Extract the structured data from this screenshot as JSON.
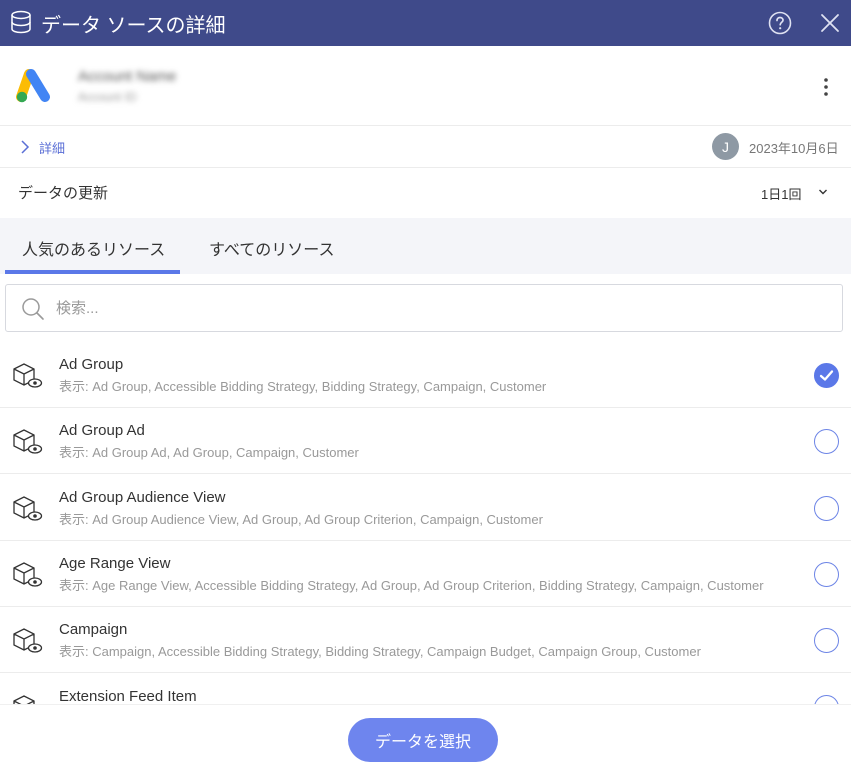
{
  "window": {
    "title": "データ ソースの詳細",
    "icons": {
      "datasource": "database-icon",
      "help": "help-icon",
      "close": "close-icon"
    }
  },
  "account": {
    "name": "Account Name",
    "sub": "Account ID",
    "icons": {
      "logo": "google-ads-logo-icon",
      "menu": "kebab-menu-icon"
    }
  },
  "details": {
    "label": "詳細",
    "avatar_initial": "J",
    "date": "2023年10月6日"
  },
  "refresh": {
    "label": "データの更新",
    "frequency": "1日1回"
  },
  "tabs": [
    {
      "label": "人気のあるリソース",
      "active": true
    },
    {
      "label": "すべてのリソース",
      "active": false
    }
  ],
  "search": {
    "placeholder": "検索..."
  },
  "resources": [
    {
      "title": "Ad Group",
      "subtitle": "表示: Ad Group, Accessible Bidding Strategy, Bidding Strategy, Campaign, Customer",
      "selected": true
    },
    {
      "title": "Ad Group Ad",
      "subtitle": "表示: Ad Group Ad, Ad Group, Campaign, Customer",
      "selected": false
    },
    {
      "title": "Ad Group Audience View",
      "subtitle": "表示: Ad Group Audience View, Ad Group, Ad Group Criterion, Campaign, Customer",
      "selected": false
    },
    {
      "title": "Age Range View",
      "subtitle": "表示: Age Range View, Accessible Bidding Strategy, Ad Group, Ad Group Criterion, Bidding Strategy, Campaign, Customer",
      "selected": false
    },
    {
      "title": "Campaign",
      "subtitle": "表示: Campaign, Accessible Bidding Strategy, Bidding Strategy, Campaign Budget, Campaign Group, Customer",
      "selected": false
    },
    {
      "title": "Extension Feed Item",
      "subtitle": "",
      "selected": false
    }
  ],
  "footer": {
    "select_label": "データを選択"
  },
  "colors": {
    "titlebar": "#3f4a8a",
    "accent": "#5b78e8",
    "button": "#6e85ee"
  }
}
